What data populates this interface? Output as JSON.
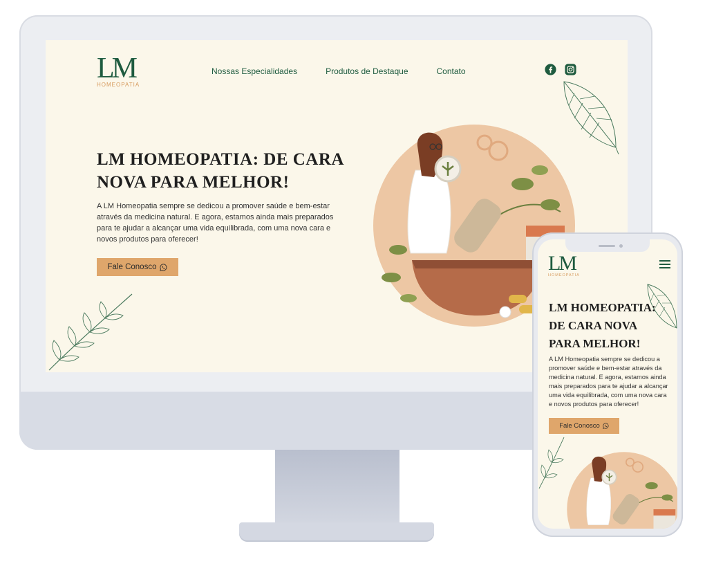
{
  "brand": {
    "logo_mark": "LM",
    "logo_sub": "HOMEOPATIA"
  },
  "nav": {
    "items": [
      {
        "label": "Nossas Especialidades"
      },
      {
        "label": "Produtos de Destaque"
      },
      {
        "label": "Contato"
      }
    ]
  },
  "social": {
    "icons": [
      "facebook-icon",
      "instagram-icon"
    ]
  },
  "hero": {
    "title": "LM HOMEOPATIA: DE CARA NOVA PARA MELHOR!",
    "text": "A LM Homeopatia sempre se dedicou a promover saúde e bem-estar através da medicina natural. E agora, estamos ainda mais preparados para te ajudar a alcançar uma vida equilibrada, com uma nova cara e novos produtos para oferecer!",
    "cta_label": "Fale Conosco",
    "cta_icon": "whatsapp-icon"
  },
  "colors": {
    "brand_green": "#1e5b3f",
    "accent_orange": "#dfa66b",
    "background_cream": "#fbf7ea",
    "circle_peach": "#edc7a4"
  }
}
